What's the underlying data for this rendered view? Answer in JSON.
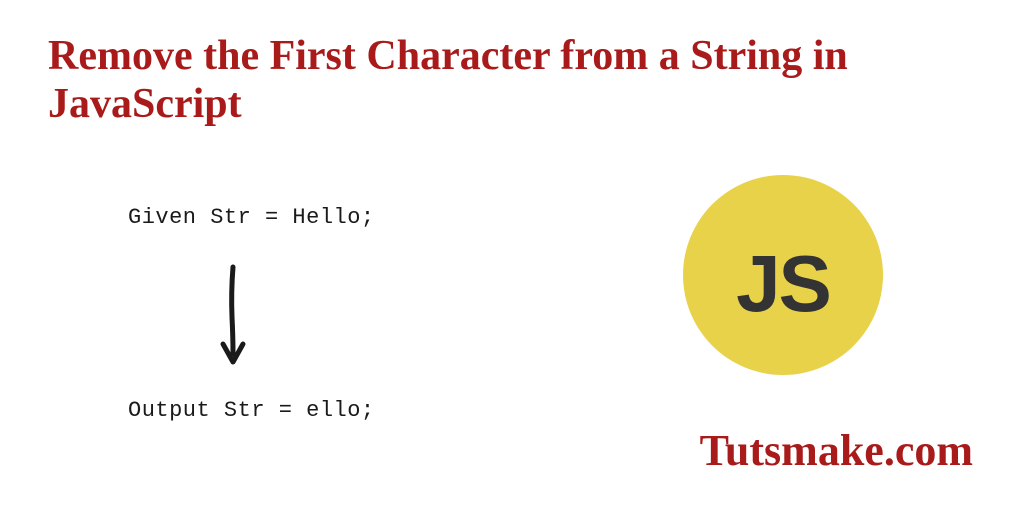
{
  "title": "Remove the First Character from a String in JavaScript",
  "example": {
    "given": "Given Str = Hello;",
    "output": "Output Str = ello;"
  },
  "badge": {
    "label": "JS"
  },
  "site": "Tutsmake.com"
}
